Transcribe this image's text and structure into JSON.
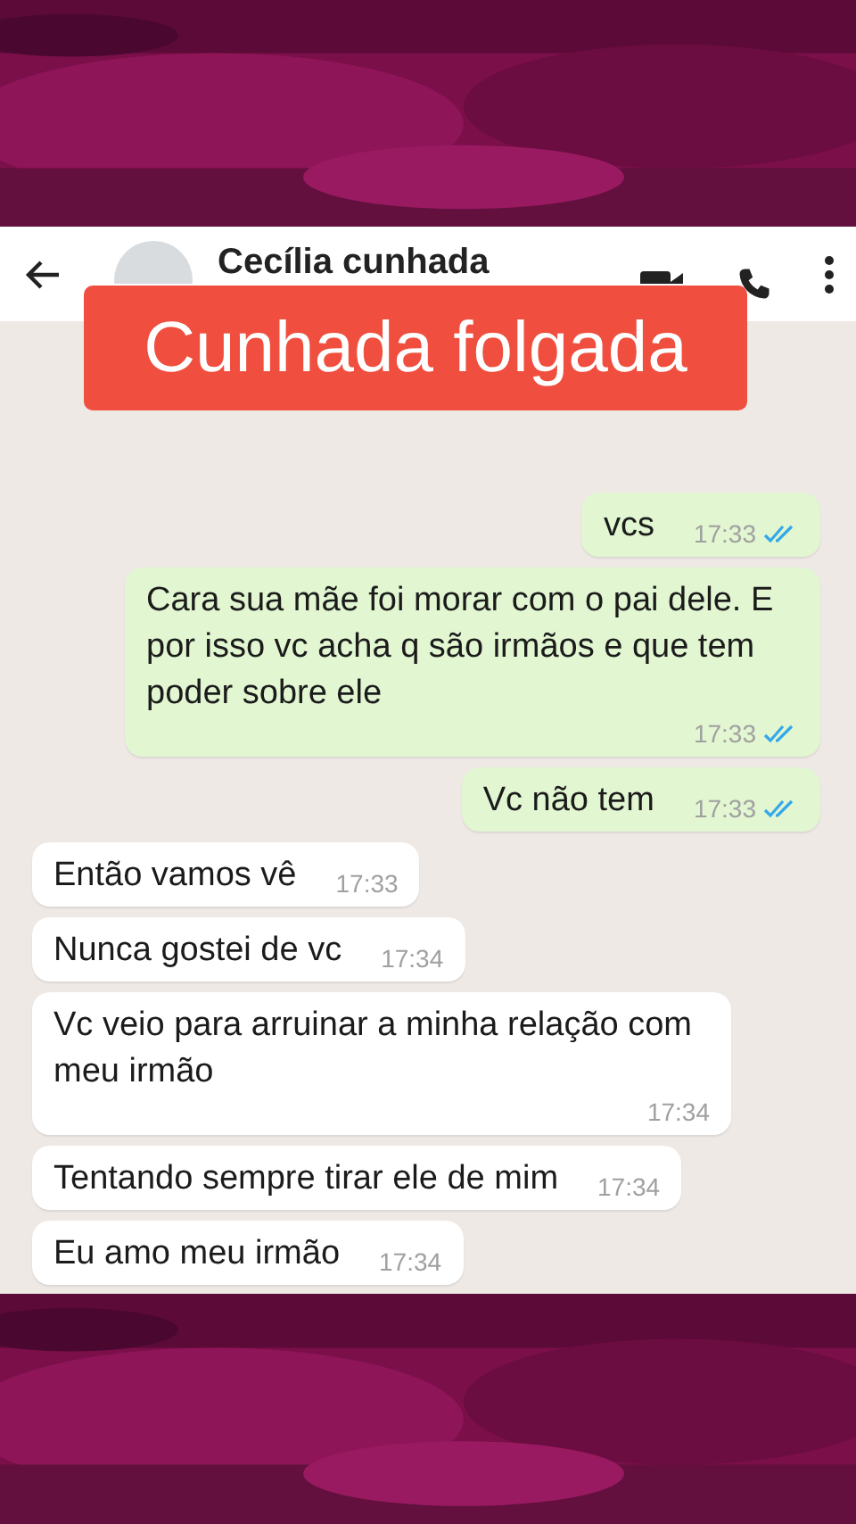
{
  "header": {
    "contact_name": "Cecília cunhada"
  },
  "caption": "Cunhada folgada",
  "messages": [
    {
      "kind": "out",
      "text": "vcs",
      "time": "17:33",
      "read": true
    },
    {
      "kind": "out",
      "text": "Cara sua mãe foi morar com o pai dele. E por isso vc acha q são irmãos e que tem poder sobre ele",
      "time": "17:33",
      "read": true
    },
    {
      "kind": "out",
      "text": "Vc não tem",
      "time": "17:33",
      "read": true
    },
    {
      "kind": "in",
      "text": "Então vamos vê",
      "time": "17:33"
    },
    {
      "kind": "in",
      "text": "Nunca gostei de vc",
      "time": "17:34"
    },
    {
      "kind": "in",
      "text": "Vc veio para arruinar a minha relação com meu irmão",
      "time": "17:34"
    },
    {
      "kind": "in",
      "text": "Tentando sempre tirar ele de mim",
      "time": "17:34"
    },
    {
      "kind": "in",
      "text": "Eu amo meu irmão",
      "time": "17:34"
    }
  ]
}
